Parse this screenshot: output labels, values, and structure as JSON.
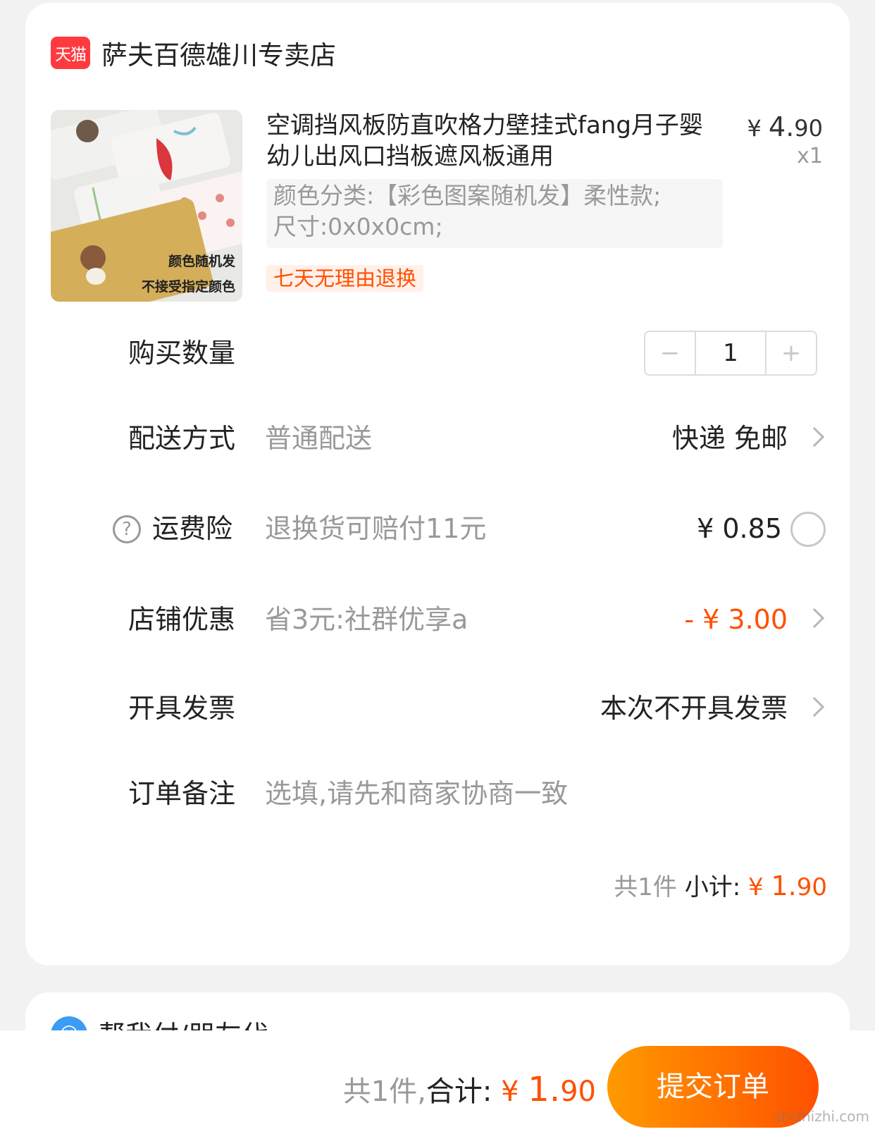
{
  "store": {
    "logo_text": "天猫",
    "name": "萨夫百德雄川专卖店"
  },
  "product": {
    "title": "空调挡风板防直吹格力壁挂式fang月子婴幼儿出风口挡板遮风板通用",
    "price_currency": "¥",
    "price_int": "4.",
    "price_dec": "90",
    "quantity_label": "x1",
    "variant_line1": "颜色分类:【彩色图案随机发】柔性款;",
    "variant_line2": "尺寸:0x0x0cm;",
    "return_badge": "七天无理由退换",
    "thumb_text1": "颜色随机发",
    "thumb_text2": "不接受指定颜色"
  },
  "quantity": {
    "label": "购买数量",
    "minus": "−",
    "value": "1",
    "plus": "+"
  },
  "delivery": {
    "label": "配送方式",
    "desc": "普通配送",
    "value": "快递 免邮"
  },
  "shipping_insurance": {
    "icon": "?",
    "label": "运费险",
    "desc": "退换货可赔付11元",
    "value": "¥ 0.85"
  },
  "store_discount": {
    "label": "店铺优惠",
    "desc": "省3元:社群优享a",
    "value": "- ¥ 3.00"
  },
  "invoice": {
    "label": "开具发票",
    "value": "本次不开具发票"
  },
  "note": {
    "label": "订单备注",
    "placeholder": "选填,请先和商家协商一致"
  },
  "subtotal": {
    "count": "共1件",
    "label": "小计:",
    "currency": "¥",
    "int": "1.",
    "dec": "90"
  },
  "pay_for_me": {
    "label": "帮我付/朋友代"
  },
  "bottom": {
    "count": "共1件,",
    "label": "合计:",
    "currency": "¥",
    "int": "1.",
    "dec": "90",
    "submit": "提交订单"
  },
  "watermark": "zhizhizhi.com",
  "colors": {
    "accent": "#ff5000",
    "tmall_red": "#ff3a3f",
    "muted": "#999999"
  }
}
